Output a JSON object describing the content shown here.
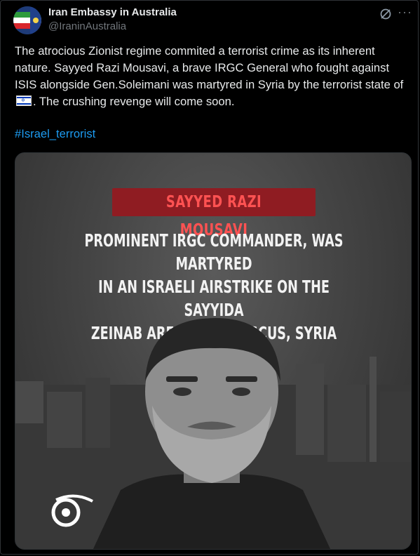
{
  "author": {
    "name": "Iran Embassy in Australia",
    "handle": "@IraninAustralia"
  },
  "post": {
    "text_1": "The atrocious Zionist regime commited a terrorist crime as its inherent nature. Sayyed Razi Mousavi, a brave IRGC General",
    "text_2": "who fought against ISIS alongside Gen.Soleimani was martyred in Syria by the terrorist state of",
    "text_3": ". The crushing revenge will come soon.",
    "hashtag": "#Israel_terrorist"
  },
  "media": {
    "banner": "SAYYED RAZI MOUSAVI",
    "headline_1": "PROMINENT IRGC COMMANDER, WAS MARTYRED",
    "headline_2": "IN AN ISRAELI AIRSTRIKE ON THE SAYYIDA",
    "headline_3": "ZEINAB AREA IN DAMASCUS, SYRIA"
  },
  "icons": {
    "grok": "grok-icon",
    "more": "more-options-icon",
    "flag": "israel-flag-emoji"
  },
  "colors": {
    "background": "#000000",
    "text": "#e7e9ea",
    "secondary": "#71767b",
    "link": "#1d9bf0",
    "banner": "#8f1c22",
    "banner_text": "#ff5252"
  }
}
